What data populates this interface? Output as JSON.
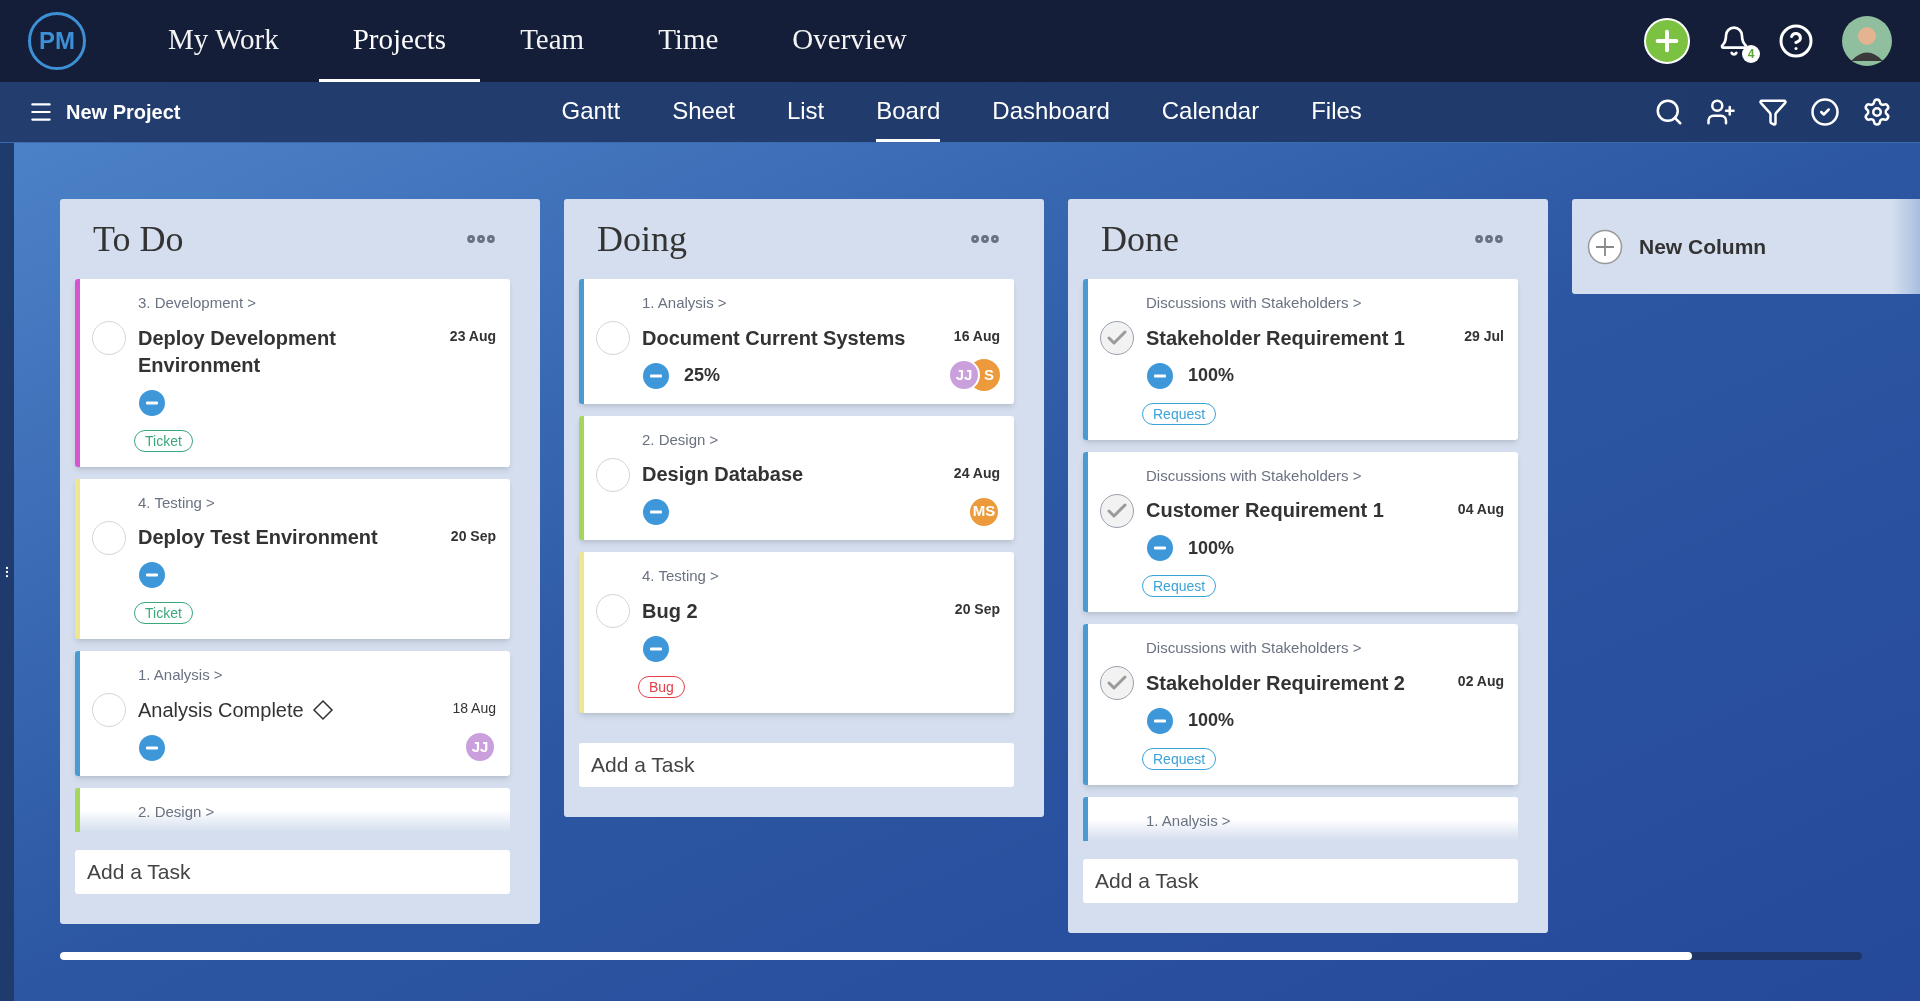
{
  "top_nav": {
    "logo": "PM",
    "items": [
      {
        "label": "My Work",
        "selected": false
      },
      {
        "label": "Projects",
        "selected": true
      },
      {
        "label": "Team",
        "selected": false
      },
      {
        "label": "Time",
        "selected": false
      },
      {
        "label": "Overview",
        "selected": false
      }
    ],
    "notification_count": "4"
  },
  "sub_nav": {
    "project": "New Project",
    "views": [
      {
        "label": "Gantt",
        "selected": false
      },
      {
        "label": "Sheet",
        "selected": false
      },
      {
        "label": "List",
        "selected": false
      },
      {
        "label": "Board",
        "selected": true
      },
      {
        "label": "Dashboard",
        "selected": false
      },
      {
        "label": "Calendar",
        "selected": false
      },
      {
        "label": "Files",
        "selected": false
      }
    ]
  },
  "columns": [
    {
      "title": "To Do",
      "cards": [
        {
          "kind": "task",
          "color": "#d655d0",
          "breadcrumb": "3. Development >",
          "title": "Deploy Development Environment",
          "date": "23 Aug",
          "done": false,
          "tag": {
            "label": "Ticket",
            "kind": "ticket"
          }
        },
        {
          "kind": "task",
          "color": "#efe78f",
          "breadcrumb": "4. Testing >",
          "title": "Deploy Test Environment",
          "date": "20 Sep",
          "done": false,
          "tag": {
            "label": "Ticket",
            "kind": "ticket"
          }
        },
        {
          "kind": "milestone",
          "color": "#4a9bd1",
          "breadcrumb": "1. Analysis >",
          "title": "Analysis Complete",
          "date": "18 Aug",
          "done": false,
          "assignees": [
            {
              "initials": "JJ",
              "color": "#c9a0dc"
            }
          ]
        }
      ],
      "partial_card": {
        "color": "#a4d65e",
        "breadcrumb": "2. Design >"
      },
      "add_task": {
        "placeholder": "Add a Task"
      }
    },
    {
      "title": "Doing",
      "cards": [
        {
          "kind": "task",
          "color": "#4a9bd1",
          "breadcrumb": "1. Analysis >",
          "title": "Document Current Systems",
          "date": "16 Aug",
          "done": false,
          "progress": "25%",
          "assignees": [
            {
              "initials": "JJ",
              "color": "#c9a0dc"
            },
            {
              "initials": "S",
              "color": "#ec9a3c"
            }
          ]
        },
        {
          "kind": "task",
          "color": "#a4d65e",
          "breadcrumb": "2. Design >",
          "title": "Design Database",
          "date": "24 Aug",
          "done": false,
          "assignees": [
            {
              "initials": "MS",
              "color": "#ec9a3c"
            }
          ]
        },
        {
          "kind": "task",
          "color": "#efe78f",
          "breadcrumb": "4. Testing >",
          "title": "Bug 2",
          "date": "20 Sep",
          "done": false,
          "tag": {
            "label": "Bug",
            "kind": "bug"
          }
        }
      ],
      "add_task": {
        "placeholder": "Add a Task"
      }
    },
    {
      "title": "Done",
      "cards": [
        {
          "kind": "task",
          "color": "#4a9bd1",
          "breadcrumb": "Discussions with Stakeholders >",
          "title": "Stakeholder Requirement 1",
          "date": "29 Jul",
          "done": true,
          "progress": "100%",
          "tag": {
            "label": "Request",
            "kind": "request"
          }
        },
        {
          "kind": "task",
          "color": "#4a9bd1",
          "breadcrumb": "Discussions with Stakeholders >",
          "title": "Customer Requirement 1",
          "date": "04 Aug",
          "done": true,
          "progress": "100%",
          "tag": {
            "label": "Request",
            "kind": "request"
          }
        },
        {
          "kind": "task",
          "color": "#4a9bd1",
          "breadcrumb": "Discussions with Stakeholders >",
          "title": "Stakeholder Requirement 2",
          "date": "02 Aug",
          "done": true,
          "progress": "100%",
          "tag": {
            "label": "Request",
            "kind": "request"
          }
        }
      ],
      "partial_card": {
        "color": "#4a9bd1",
        "breadcrumb": "1. Analysis >"
      },
      "add_task": {
        "placeholder": "Add a Task"
      }
    }
  ],
  "new_column": {
    "label": "New Column"
  }
}
